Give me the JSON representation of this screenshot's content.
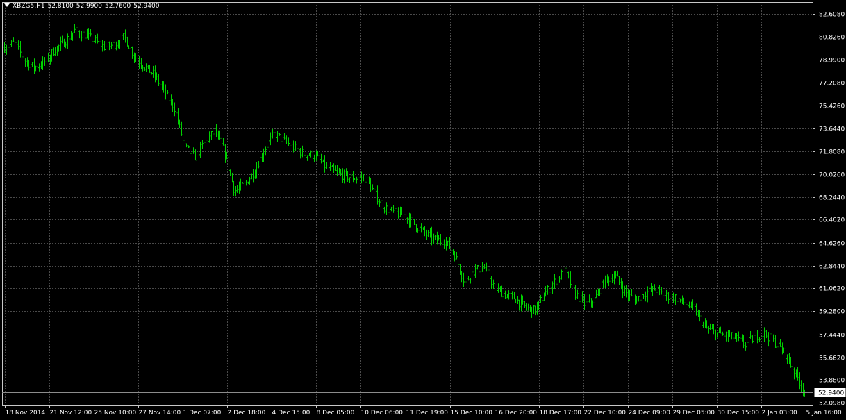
{
  "header": {
    "symbol": "XBZG5,H1",
    "open": "52.8100",
    "high": "52.9900",
    "low": "52.7600",
    "close": "52.9400"
  },
  "colors": {
    "background": "#000000",
    "grid": "#4a4a4a",
    "axis": "#c8c8c8",
    "bar": "#00d000",
    "text": "#ffffff",
    "price_line": "#8c8c8c"
  },
  "icons": {
    "menu": "triangle-down-icon"
  },
  "chart_data": {
    "type": "ohlc",
    "title": "XBZG5,H1",
    "grid": true,
    "y_axis_position": "right",
    "ylim": [
      52.098,
      82.608
    ],
    "y_ticks": [
      "82.6080",
      "80.8260",
      "78.9900",
      "77.2080",
      "75.4260",
      "73.6440",
      "71.8080",
      "70.0260",
      "68.2440",
      "66.4620",
      "64.6260",
      "62.8440",
      "61.0620",
      "59.2800",
      "57.4440",
      "55.6620",
      "53.8800",
      "52.0980"
    ],
    "x_ticks": [
      "18 Nov 2014",
      "21 Nov 12:00",
      "25 Nov 10:00",
      "27 Nov 14:00",
      "1 Dec 07:00",
      "2 Dec 18:00",
      "4 Dec 15:00",
      "8 Dec 05:00",
      "10 Dec 06:00",
      "11 Dec 19:00",
      "15 Dec 10:00",
      "16 Dec 20:00",
      "18 Dec 17:00",
      "22 Dec 10:00",
      "24 Dec 09:00",
      "29 Dec 05:00",
      "30 Dec 15:00",
      "2 Jan 03:00",
      "5 Jan 16:00"
    ],
    "current_price": "52.9400",
    "bars_per_xtick": 25,
    "close_path": [
      80.0,
      80.3,
      79.0,
      78.4,
      78.8,
      79.8,
      80.4,
      81.3,
      81.0,
      80.5,
      80.0,
      80.2,
      80.8,
      79.3,
      78.5,
      77.8,
      76.5,
      75.2,
      72.2,
      71.3,
      72.5,
      73.4,
      71.8,
      68.7,
      69.2,
      70.3,
      72.0,
      73.2,
      72.6,
      72.1,
      71.6,
      71.5,
      70.7,
      70.2,
      69.9,
      69.7,
      69.8,
      68.5,
      67.4,
      67.0,
      66.8,
      66.1,
      65.4,
      64.9,
      64.8,
      63.7,
      61.5,
      62.5,
      62.7,
      61.1,
      60.6,
      60.3,
      59.6,
      59.3,
      60.7,
      61.6,
      62.4,
      60.7,
      59.8,
      60.2,
      61.7,
      62.1,
      60.8,
      60.1,
      60.7,
      61.0,
      60.5,
      60.4,
      59.9,
      59.4,
      58.0,
      57.6,
      57.4,
      57.2,
      56.6,
      57.3,
      57.5,
      56.8,
      56.0,
      54.5,
      52.94
    ]
  }
}
